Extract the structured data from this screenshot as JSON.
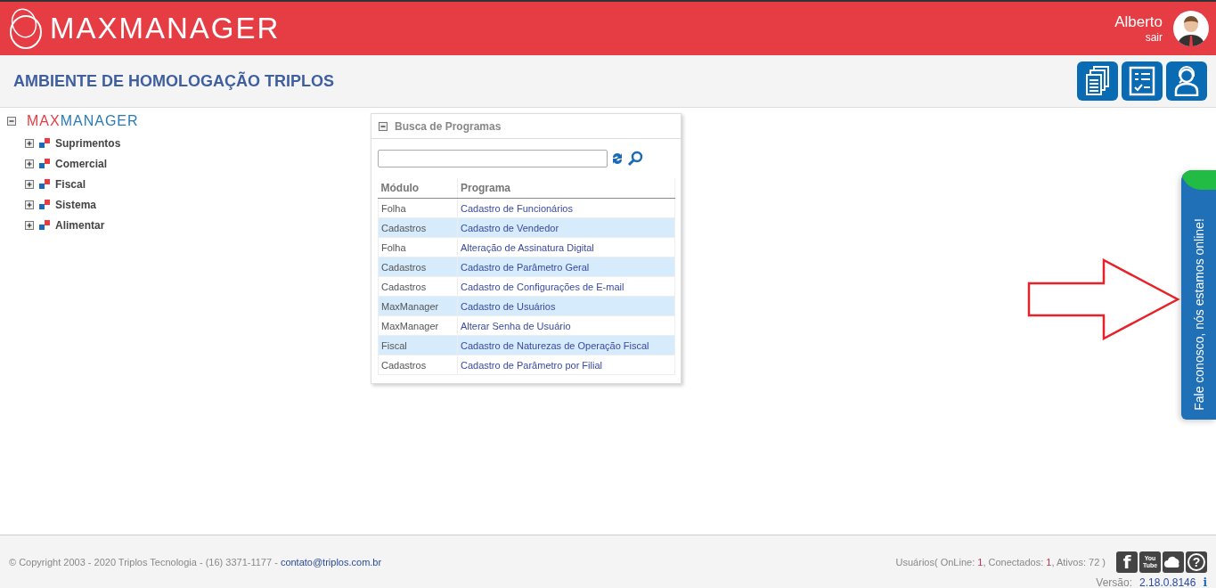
{
  "header": {
    "logo": "MAXMANAGER",
    "user_name": "Alberto",
    "logout_link": "sair"
  },
  "subheader": {
    "title": "AMBIENTE DE HOMOLOGAÇÃO TRIPLOS",
    "buttons": [
      {
        "kind": "documents"
      },
      {
        "kind": "checklist"
      },
      {
        "kind": "support"
      }
    ]
  },
  "tree": {
    "root": {
      "logo_part_1": "MAX",
      "logo_part_2": "MANAGER",
      "expanded": true
    },
    "children": [
      {
        "label": "Suprimentos",
        "expanded": false
      },
      {
        "label": "Comercial",
        "expanded": false
      },
      {
        "label": "Fiscal",
        "expanded": false
      },
      {
        "label": "Sistema",
        "expanded": false
      },
      {
        "label": "Alimentar",
        "expanded": false
      }
    ]
  },
  "program_search": {
    "title": "Busca de Programas",
    "expanded": true,
    "table": {
      "columns": [
        "Módulo",
        "Programa"
      ],
      "rows": [
        [
          "Folha",
          "Cadastro de Funcionários"
        ],
        [
          "Cadastros",
          "Cadastro de Vendedor"
        ],
        [
          "Folha",
          "Alteração de Assinatura Digital"
        ],
        [
          "Cadastros",
          "Cadastro de Parâmetro Geral"
        ],
        [
          "Cadastros",
          "Cadastro de Configurações de E-mail"
        ],
        [
          "MaxManager",
          "Cadastro de Usuários"
        ],
        [
          "MaxManager",
          "Alterar Senha de Usuário"
        ],
        [
          "Fiscal",
          "Cadastro de Naturezas de Operação Fiscal"
        ],
        [
          "Cadastros",
          "Cadastro de Parâmetro por Filial"
        ]
      ]
    }
  },
  "chat_tab": {
    "label": "Fale conosco, nós estamos online!"
  },
  "footer": {
    "copyright": "© Copyright 2003 - 2020 Triplos Tecnologia - (16) 3371-1177 - ",
    "email_link": "contato@triplos.com.br",
    "users_label": "Usuários( OnLine: ",
    "online": "1",
    "connected_label": ", Conectados: ",
    "connected": "1",
    "active_label": ", Ativos: 72 )",
    "social_icons": [
      {
        "kind": "facebook",
        "glyph": "f"
      },
      {
        "kind": "youtube",
        "glyph": "You Tube"
      },
      {
        "kind": "cloud"
      },
      {
        "kind": "help",
        "glyph": "?"
      }
    ],
    "version_label": "Versão:",
    "version": "2.18.0.8146",
    "version_info": "i"
  }
}
